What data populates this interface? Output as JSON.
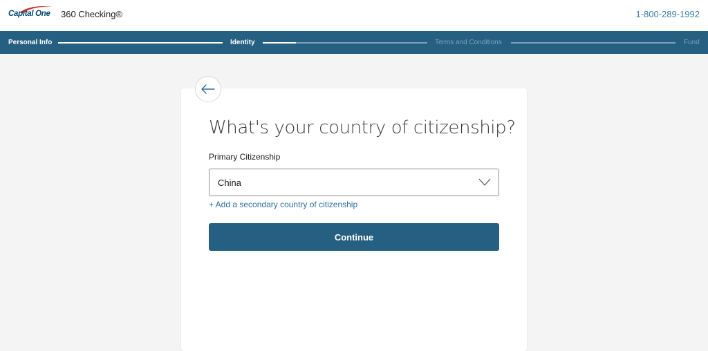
{
  "header": {
    "logo_text": "Capital One",
    "product_name": "360 Checking®",
    "phone": "1-800-289-1992"
  },
  "progress": {
    "steps": [
      {
        "label": "Personal Info",
        "state": "done"
      },
      {
        "label": "Identity",
        "state": "current"
      },
      {
        "label": "Terms and Conditions",
        "state": "upcoming"
      },
      {
        "label": "Fund",
        "state": "upcoming"
      }
    ],
    "identity_segment_progress": 0.2
  },
  "form": {
    "title": "What's your country of citizenship?",
    "field_label": "Primary Citizenship",
    "selected_value": "China",
    "add_secondary_link": "+ Add a secondary country of citizenship",
    "continue_label": "Continue"
  },
  "colors": {
    "brand_blue": "#255f82",
    "link_blue": "#2a6f9e",
    "logo_red": "#d22e1e"
  }
}
